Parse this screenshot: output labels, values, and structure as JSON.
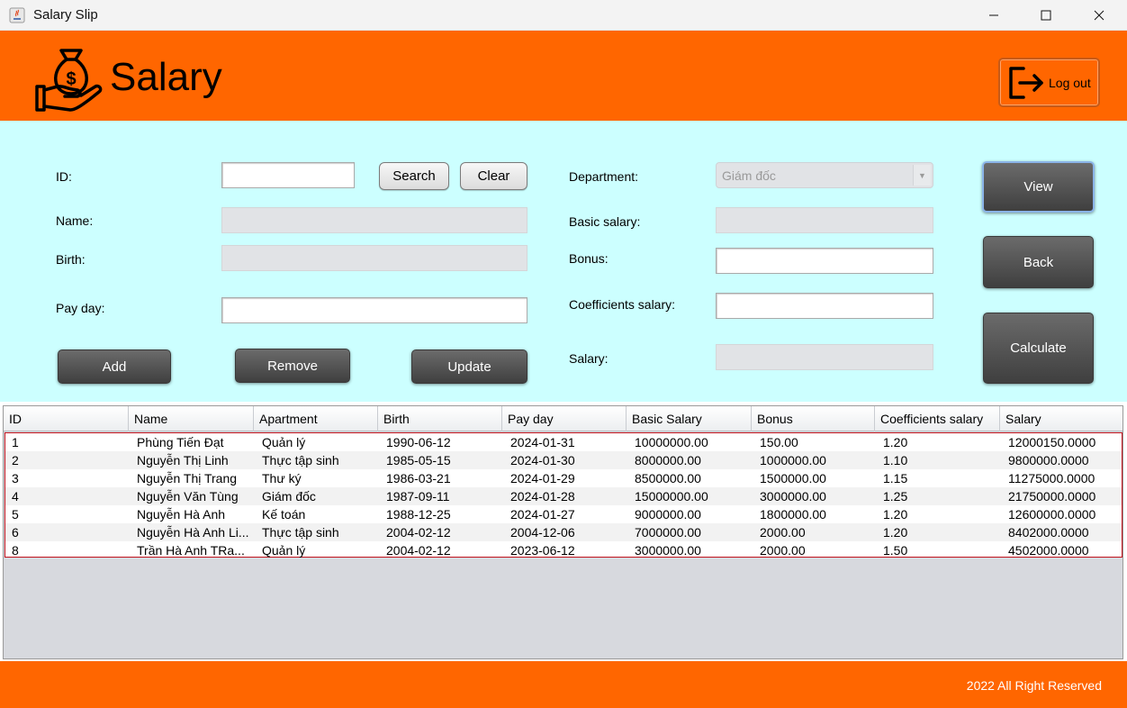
{
  "window": {
    "title": "Salary Slip",
    "minimize_glyph": "—",
    "maximize_glyph": "☐",
    "close_glyph": "✕"
  },
  "header": {
    "title": "Salary",
    "logout_label": "Log out",
    "logo_icon": "money-bag-hand-icon",
    "logout_icon": "logout-icon",
    "accent_color": "#ff6600"
  },
  "form": {
    "id_label": "ID:",
    "id_value": "",
    "search_label": "Search",
    "clear_label": "Clear",
    "name_label": "Name:",
    "name_value": "",
    "birth_label": "Birth:",
    "birth_value": "",
    "payday_label": "Pay day:",
    "payday_value": "",
    "department_label": "Department:",
    "department_value": "Giám đốc",
    "basic_salary_label": "Basic salary:",
    "basic_salary_value": "",
    "bonus_label": "Bonus:",
    "bonus_value": "",
    "coefficients_label": "Coefficients salary:",
    "coefficients_value": "",
    "salary_label": "Salary:",
    "salary_value": "",
    "add_label": "Add",
    "remove_label": "Remove",
    "update_label": "Update",
    "view_label": "View",
    "back_label": "Back",
    "calculate_label": "Calculate",
    "panel_color": "#ccffff"
  },
  "table": {
    "columns": [
      "ID",
      "Name",
      "Apartment",
      "Birth",
      "Pay day",
      "Basic Salary",
      "Bonus",
      "Coefficients salary",
      "Salary"
    ],
    "rows": [
      [
        "1",
        "Phùng Tiến Đạt",
        "Quản lý",
        "1990-06-12",
        "2024-01-31",
        "10000000.00",
        "150.00",
        "1.20",
        "12000150.0000"
      ],
      [
        "2",
        "Nguyễn Thị Linh",
        "Thực tập sinh",
        "1985-05-15",
        "2024-01-30",
        "8000000.00",
        "1000000.00",
        "1.10",
        "9800000.0000"
      ],
      [
        "3",
        "Nguyễn Thị Trang",
        "Thư ký",
        "1986-03-21",
        "2024-01-29",
        "8500000.00",
        "1500000.00",
        "1.15",
        "11275000.0000"
      ],
      [
        "4",
        "Nguyễn Văn Tùng",
        "Giám đốc",
        "1987-09-11",
        "2024-01-28",
        "15000000.00",
        "3000000.00",
        "1.25",
        "21750000.0000"
      ],
      [
        "5",
        "Nguyễn Hà Anh",
        "Kế toán",
        "1988-12-25",
        "2024-01-27",
        "9000000.00",
        "1800000.00",
        "1.20",
        "12600000.0000"
      ],
      [
        "6",
        "Nguyễn Hà Anh Li...",
        "Thực tập sinh",
        "2004-02-12",
        "2004-12-06",
        "7000000.00",
        "2000.00",
        "1.20",
        "8402000.0000"
      ],
      [
        "8",
        "Trần Hà Anh TRa...",
        "Quản lý",
        "2004-02-12",
        "2023-06-12",
        "3000000.00",
        "2000.00",
        "1.50",
        "4502000.0000"
      ]
    ]
  },
  "footer": {
    "text": "2022 All Right Reserved"
  }
}
